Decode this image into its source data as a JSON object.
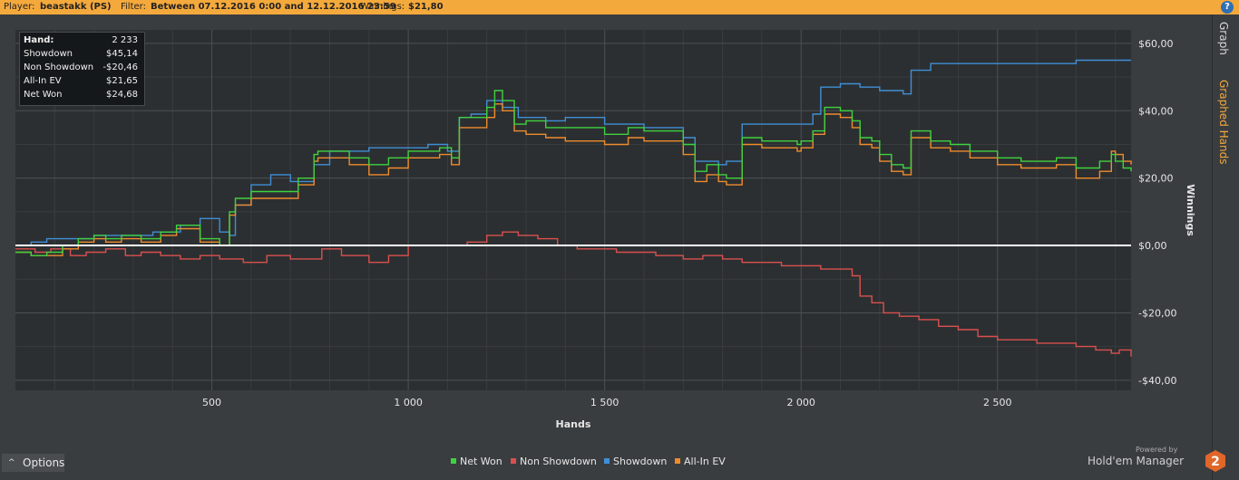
{
  "header": {
    "player_label": "Player:",
    "player": "beastakk (PS)",
    "filter_label": "Filter:",
    "filter": "Between 07.12.2016 0:00 and 12.12.2016 23:59",
    "winnings_label": "Winnings:",
    "winnings": "$21,80",
    "help": "?"
  },
  "tabs": {
    "graph": "Graph",
    "graphed_hands": "Graphed Hands"
  },
  "stats": [
    {
      "label": "Hand:",
      "value": "2 233"
    },
    {
      "label": "Showdown",
      "value": "$45,14"
    },
    {
      "label": "Non Showdown",
      "value": "-$20,46"
    },
    {
      "label": "All-In EV",
      "value": "$21,65"
    },
    {
      "label": "Net Won",
      "value": "$24,68"
    }
  ],
  "options": {
    "caret": "^",
    "label": "Options"
  },
  "powered": {
    "line1": "Powered by",
    "brand": "Hold'em Manager",
    "badge": "2"
  },
  "colors": {
    "net_won": "#3fd23f",
    "non_showdown": "#d9504f",
    "showdown": "#3f8fd6",
    "allin_ev": "#ee8c2c",
    "zero_line": "#ffffff"
  },
  "chart_data": {
    "type": "line",
    "xlabel": "Hands",
    "ylabel": "Winnings",
    "xlim": [
      0,
      2840
    ],
    "ylim": [
      -43,
      64
    ],
    "xticks": [
      500,
      1000,
      1500,
      2000,
      2500
    ],
    "xtick_labels": [
      "500",
      "1 000",
      "1 500",
      "2 000",
      "2 500"
    ],
    "yticks": [
      60,
      40,
      20,
      0,
      -20,
      -40
    ],
    "ytick_labels": [
      "$60,00",
      "$40,00",
      "$20,00",
      "$0,00",
      "-$20,00",
      "-$40,00"
    ],
    "grid": true,
    "legend_position": "bottom",
    "series": [
      {
        "name": "Net Won",
        "color": "#3fd23f",
        "x": [
          0,
          40,
          80,
          120,
          160,
          200,
          230,
          270,
          320,
          370,
          410,
          470,
          520,
          545,
          560,
          600,
          660,
          720,
          760,
          770,
          800,
          850,
          900,
          950,
          1000,
          1050,
          1080,
          1110,
          1130,
          1160,
          1200,
          1220,
          1240,
          1270,
          1300,
          1350,
          1400,
          1450,
          1500,
          1560,
          1600,
          1650,
          1700,
          1720,
          1730,
          1760,
          1790,
          1810,
          1850,
          1900,
          1950,
          1990,
          2000,
          2030,
          2060,
          2100,
          2130,
          2150,
          2180,
          2200,
          2230,
          2260,
          2280,
          2330,
          2380,
          2430,
          2500,
          2560,
          2600,
          2650,
          2700,
          2760,
          2790,
          2800,
          2820,
          2840
        ],
        "y": [
          -2,
          -3,
          -2,
          0,
          2,
          3,
          2,
          3,
          2,
          4,
          6,
          2,
          0,
          10,
          14,
          16,
          16,
          20,
          27,
          28,
          28,
          26,
          24,
          26,
          28,
          28,
          29,
          26,
          38,
          38,
          41,
          46,
          43,
          36,
          37,
          35,
          35,
          35,
          33,
          35,
          34,
          34,
          30,
          30,
          22,
          24,
          21,
          20,
          32,
          31,
          31,
          30,
          31,
          34,
          41,
          40,
          37,
          32,
          31,
          27,
          24,
          23,
          34,
          31,
          30,
          28,
          26,
          25,
          25,
          26,
          23,
          25,
          27,
          25,
          23,
          22
        ]
      },
      {
        "name": "Non Showdown",
        "color": "#d9504f",
        "x": [
          0,
          50,
          90,
          140,
          180,
          230,
          280,
          320,
          370,
          420,
          470,
          520,
          580,
          640,
          700,
          780,
          830,
          900,
          950,
          1000,
          1050,
          1100,
          1150,
          1200,
          1240,
          1280,
          1330,
          1380,
          1430,
          1480,
          1530,
          1580,
          1630,
          1700,
          1750,
          1800,
          1850,
          1900,
          1950,
          2000,
          2050,
          2100,
          2130,
          2150,
          2180,
          2210,
          2250,
          2300,
          2350,
          2400,
          2450,
          2500,
          2550,
          2600,
          2650,
          2700,
          2750,
          2790,
          2810,
          2840
        ],
        "y": [
          -1,
          -2,
          -1,
          -3,
          -2,
          -1,
          -3,
          -2,
          -3,
          -4,
          -3,
          -4,
          -5,
          -3,
          -4,
          -1,
          -3,
          -5,
          -3,
          0,
          0,
          0,
          1,
          3,
          4,
          3,
          2,
          0,
          -1,
          -1,
          -2,
          -2,
          -3,
          -4,
          -3,
          -4,
          -5,
          -5,
          -6,
          -6,
          -7,
          -7,
          -9,
          -15,
          -17,
          -20,
          -21,
          -22,
          -24,
          -25,
          -27,
          -28,
          -28,
          -29,
          -29,
          -30,
          -31,
          -32,
          -31,
          -33
        ]
      },
      {
        "name": "Showdown",
        "color": "#3f8fd6",
        "x": [
          0,
          40,
          80,
          120,
          200,
          280,
          350,
          420,
          470,
          520,
          545,
          560,
          600,
          650,
          700,
          760,
          800,
          900,
          1000,
          1050,
          1100,
          1130,
          1160,
          1200,
          1240,
          1280,
          1350,
          1400,
          1500,
          1600,
          1650,
          1700,
          1730,
          1760,
          1790,
          1810,
          1850,
          1900,
          1950,
          2000,
          2030,
          2050,
          2100,
          2150,
          2200,
          2260,
          2280,
          2330,
          2400,
          2500,
          2600,
          2700,
          2800,
          2840
        ],
        "y": [
          0,
          1,
          2,
          2,
          3,
          3,
          4,
          6,
          8,
          4,
          3,
          12,
          18,
          21,
          19,
          24,
          28,
          29,
          29,
          30,
          28,
          38,
          39,
          43,
          41,
          38,
          37,
          38,
          36,
          35,
          35,
          32,
          25,
          25,
          24,
          25,
          36,
          36,
          36,
          36,
          39,
          47,
          48,
          47,
          46,
          45,
          52,
          54,
          54,
          54,
          54,
          55,
          55,
          55
        ]
      },
      {
        "name": "All-In EV",
        "color": "#ee8c2c",
        "x": [
          0,
          40,
          80,
          120,
          160,
          200,
          230,
          270,
          320,
          370,
          410,
          470,
          520,
          545,
          560,
          600,
          660,
          720,
          760,
          770,
          800,
          850,
          900,
          950,
          1000,
          1050,
          1080,
          1110,
          1130,
          1160,
          1200,
          1220,
          1240,
          1270,
          1300,
          1350,
          1400,
          1450,
          1500,
          1560,
          1600,
          1650,
          1700,
          1720,
          1730,
          1760,
          1790,
          1810,
          1850,
          1900,
          1950,
          1990,
          2000,
          2030,
          2060,
          2100,
          2130,
          2150,
          2180,
          2200,
          2230,
          2260,
          2280,
          2330,
          2380,
          2430,
          2500,
          2560,
          2600,
          2650,
          2700,
          2760,
          2790,
          2800,
          2820,
          2840
        ],
        "y": [
          -2,
          -3,
          -3,
          -1,
          1,
          2,
          1,
          2,
          1,
          3,
          5,
          1,
          0,
          9,
          12,
          14,
          14,
          18,
          25,
          26,
          26,
          24,
          21,
          23,
          26,
          26,
          27,
          24,
          35,
          35,
          38,
          42,
          40,
          34,
          33,
          32,
          31,
          31,
          30,
          32,
          31,
          31,
          27,
          27,
          19,
          21,
          19,
          18,
          30,
          29,
          29,
          28,
          29,
          33,
          39,
          38,
          35,
          30,
          29,
          25,
          22,
          21,
          32,
          29,
          28,
          26,
          24,
          23,
          23,
          24,
          20,
          22,
          28,
          27,
          25,
          24
        ]
      }
    ]
  }
}
